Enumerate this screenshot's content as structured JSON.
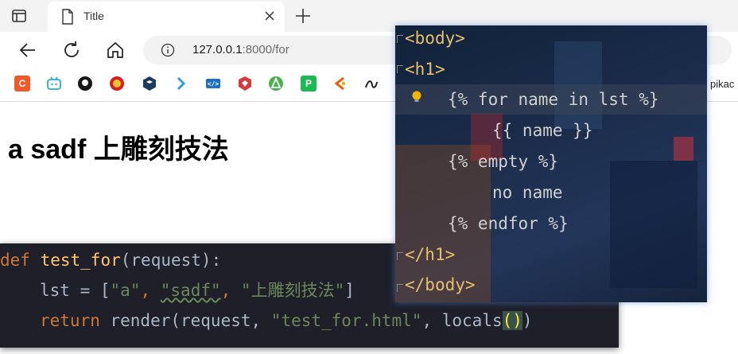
{
  "browser": {
    "tab": {
      "title": "Title"
    },
    "address": {
      "host": "127.0.0.1",
      "rest": ":8000/for"
    },
    "bookmarks": {
      "overflow_label": "pikac"
    }
  },
  "page": {
    "heading": "a sadf 上雕刻技法"
  },
  "python_editor": {
    "line1": {
      "kw": "def",
      "fname": "test_for",
      "open": "(",
      "arg": "request",
      "close": "):"
    },
    "line2": {
      "var": "lst",
      "eq": " = ",
      "lb": "[",
      "s1": "\"a\"",
      "c1": ", ",
      "s2": "\"sadf\"",
      "c2": ", ",
      "s3": "\"上雕刻技法\"",
      "rb": "]"
    },
    "line3": {
      "kw": "return",
      "call": " render(request, ",
      "s": "\"test_for.html\"",
      "c": ", locals",
      "paren": "()",
      "end": ")"
    }
  },
  "template_editor": {
    "lines": [
      {
        "open": "<",
        "tag": "body",
        "close": ">"
      },
      {
        "open": "<",
        "tag": "h1",
        "close": ">"
      },
      {
        "text": "{% for name in lst %}"
      },
      {
        "text": "{{ name }}"
      },
      {
        "text": "{% empty %}"
      },
      {
        "text": "no name"
      },
      {
        "text": "{% endfor %}"
      },
      {
        "open": "</",
        "tag": "h1",
        "close": ">"
      },
      {
        "open": "</",
        "tag": "body",
        "close": ">"
      }
    ]
  },
  "colors": {
    "python_keyword": "#cc7832",
    "python_function": "#ffc66d",
    "python_string": "#6a8759",
    "tag_color": "#e8bf6a"
  }
}
